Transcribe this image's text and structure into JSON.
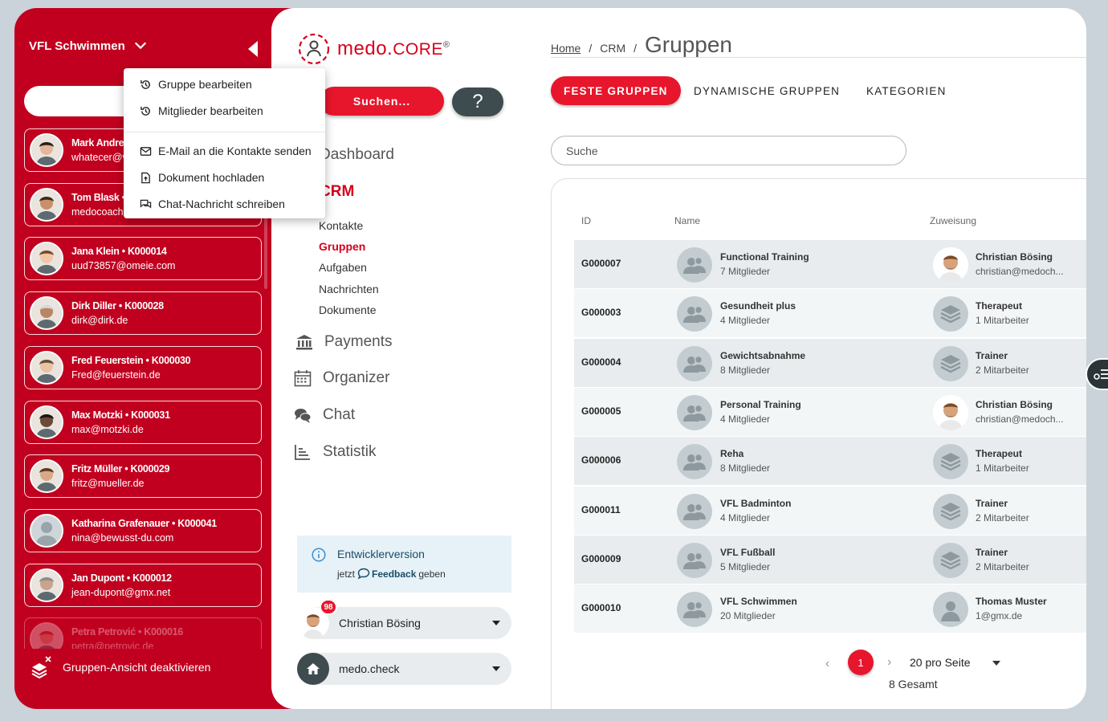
{
  "sidebar": {
    "org": "VFL Schwimmen",
    "footer": "Gruppen-Ansicht deaktivieren",
    "contacts": [
      {
        "name": "Mark Andre",
        "email": "whatecer@v"
      },
      {
        "name": "Tom Blask •",
        "email": "medocoach"
      },
      {
        "name": "Jana Klein • K000014",
        "email": "uud73857@omeie.com"
      },
      {
        "name": "Dirk Diller • K000028",
        "email": "dirk@dirk.de"
      },
      {
        "name": "Fred Feuerstein • K000030",
        "email": "Fred@feuerstein.de"
      },
      {
        "name": "Max Motzki • K000031",
        "email": "max@motzki.de"
      },
      {
        "name": "Fritz Müller • K000029",
        "email": "fritz@mueller.de"
      },
      {
        "name": "Katharina Grafenauer • K000041",
        "email": "nina@bewusst-du.com"
      },
      {
        "name": "Jan Dupont • K000012",
        "email": "jean-dupont@gmx.net"
      },
      {
        "name": "Petra Petrović • K000016",
        "email": "petra@petrovic.de"
      }
    ]
  },
  "menu": {
    "items": [
      "Gruppe bearbeiten",
      "Mitglieder bearbeiten",
      "E-Mail an die Kontakte senden",
      "Dokument hochladen",
      "Chat-Nachricht schreiben"
    ]
  },
  "nav": {
    "logo": "medo.",
    "logo_core": "CORE",
    "logo_reg": "®",
    "search_btn": "Suchen...",
    "help_btn": "?",
    "dashboard": "Dashboard",
    "crm": "CRM",
    "crm_items": [
      "Kontakte",
      "Gruppen",
      "Aufgaben",
      "Nachrichten",
      "Dokumente"
    ],
    "payments": "Payments",
    "organizer": "Organizer",
    "chat": "Chat",
    "statistik": "Statistik",
    "dev_title": "Entwicklerversion",
    "dev_pre": "jetzt",
    "dev_link": "Feedback",
    "dev_post": "geben",
    "user": "Christian Bösing",
    "user_badge": "98",
    "workspace": "medo.check"
  },
  "content": {
    "breadcrumb": {
      "home": "Home",
      "sep": "/",
      "crm": "CRM",
      "title": "Gruppen"
    },
    "tabs": [
      "FESTE GRUPPEN",
      "DYNAMISCHE GRUPPEN",
      "KATEGORIEN"
    ],
    "search_placeholder": "Suche",
    "headers": {
      "id": "ID",
      "name": "Name",
      "assign": "Zuweisung"
    },
    "rows": [
      {
        "id": "G000007",
        "name": "Functional Training",
        "members": "7 Mitglieder",
        "assignee": "Christian Bösing",
        "assignee_sub": "christian@medoch...",
        "type": "person"
      },
      {
        "id": "G000003",
        "name": "Gesundheit plus",
        "members": "4 Mitglieder",
        "assignee": "Therapeut",
        "assignee_sub": "1 Mitarbeiter",
        "type": "stack"
      },
      {
        "id": "G000004",
        "name": "Gewichtsabnahme",
        "members": "8 Mitglieder",
        "assignee": "Trainer",
        "assignee_sub": "2 Mitarbeiter",
        "type": "stack"
      },
      {
        "id": "G000005",
        "name": "Personal Training",
        "members": "4 Mitglieder",
        "assignee": "Christian Bösing",
        "assignee_sub": "christian@medoch...",
        "type": "person"
      },
      {
        "id": "G000006",
        "name": "Reha",
        "members": "8 Mitglieder",
        "assignee": "Therapeut",
        "assignee_sub": "1 Mitarbeiter",
        "type": "stack"
      },
      {
        "id": "G000011",
        "name": "VFL Badminton",
        "members": "4 Mitglieder",
        "assignee": "Trainer",
        "assignee_sub": "2 Mitarbeiter",
        "type": "stack"
      },
      {
        "id": "G000009",
        "name": "VFL Fußball",
        "members": "5 Mitglieder",
        "assignee": "Trainer",
        "assignee_sub": "2 Mitarbeiter",
        "type": "stack"
      },
      {
        "id": "G000010",
        "name": "VFL Schwimmen",
        "members": "20 Mitglieder",
        "assignee": "Thomas Muster",
        "assignee_sub": "1@gmx.de",
        "type": "user"
      }
    ],
    "pager": {
      "page": "1",
      "size": "20 pro Seite",
      "total": "8 Gesamt",
      "prev": "‹",
      "next": "›"
    }
  }
}
